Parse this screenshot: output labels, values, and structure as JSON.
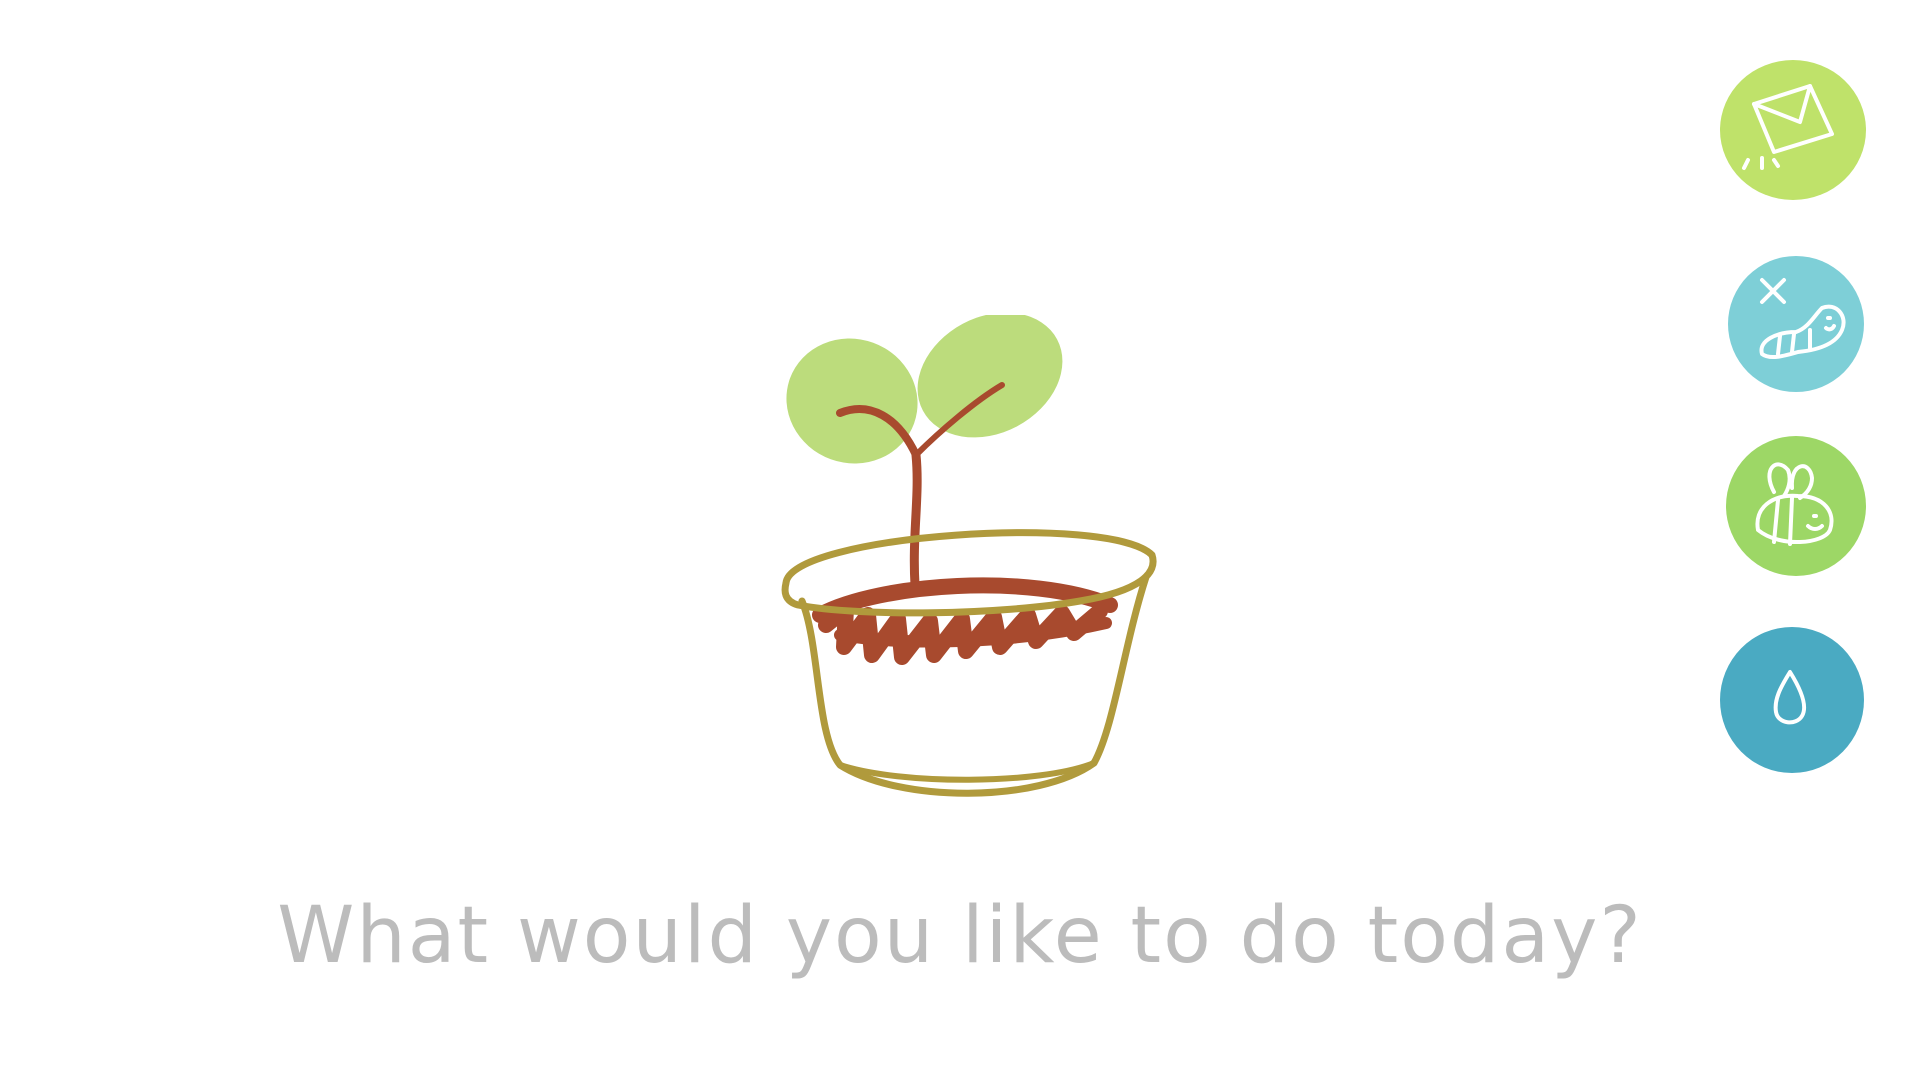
{
  "prompt": {
    "text": "What would you like to do today?"
  },
  "scene": {
    "illustration": "seedling-in-pot",
    "colors": {
      "leaf": "#bcdc7c",
      "stem_soil": "#a84a2e",
      "pot_outline": "#b09a3c",
      "prompt_text": "#bcbcbc"
    }
  },
  "actions": [
    {
      "icon": "envelope-icon",
      "color": "#bfe26a"
    },
    {
      "icon": "caterpillar-icon",
      "color": "#7ecfd7"
    },
    {
      "icon": "bee-icon",
      "color": "#9dd766"
    },
    {
      "icon": "water-drop-icon",
      "color": "#4aaac2"
    }
  ]
}
